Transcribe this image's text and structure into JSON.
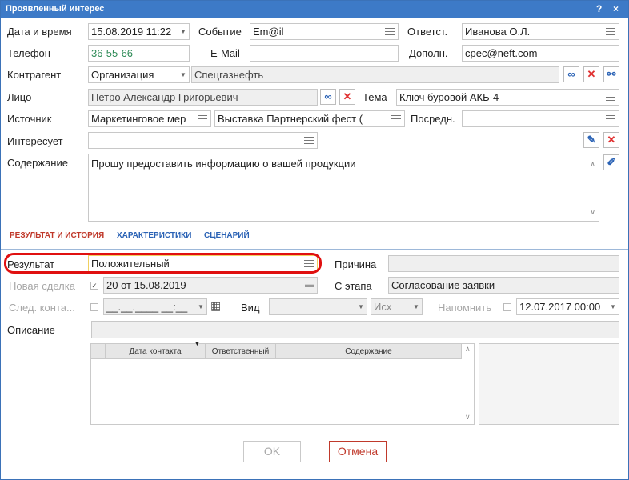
{
  "window": {
    "title": "Проявленный интерес",
    "help": "?",
    "close": "×"
  },
  "row1": {
    "datetime_label": "Дата и время",
    "datetime_value": "15.08.2019 11:22",
    "event_label": "Событие",
    "event_value": "Em@il",
    "resp_label": "Ответст.",
    "resp_value": "Иванова О.Л."
  },
  "row2": {
    "phone_label": "Телефон",
    "phone_value": "36-55-66",
    "email_label": "E-Mail",
    "email_value": "",
    "extra_label": "Дополн.",
    "extra_value": "cpec@neft.com"
  },
  "row3": {
    "contractor_label": "Контрагент",
    "contractor_type": "Организация",
    "contractor_value": "Спецгазнефть"
  },
  "row4": {
    "person_label": "Лицо",
    "person_value": "Петро Александр Григорьевич",
    "topic_label": "Тема",
    "topic_value": "Ключ буровой АКБ-4"
  },
  "row5": {
    "source_label": "Источник",
    "source_value": "Маркетинговое мер",
    "source2_value": "Выставка Партнерский фест (",
    "mediator_label": "Посредн.",
    "mediator_value": ""
  },
  "row6": {
    "interest_label": "Интересует",
    "interest_value": ""
  },
  "content": {
    "label": "Содержание",
    "value": "Прошу предоставить информацию о вашей продукции"
  },
  "tabs": [
    "РЕЗУЛЬТАТ И ИСТОРИЯ",
    "ХАРАКТЕРИСТИКИ",
    "СЦЕНАРИЙ"
  ],
  "result": {
    "result_label": "Результат",
    "result_value": "Положительный",
    "reason_label": "Причина",
    "reason_value": "",
    "deal_label": "Новая сделка",
    "deal_value": "20 от 15.08.2019",
    "stage_label": "С этапа",
    "stage_value": "Согласование заявки",
    "next_label": "След. конта...",
    "next_value": "__.__.____ __:__",
    "kind_label": "Вид",
    "kind_value": "",
    "dir_value": "Исх",
    "remind_label": "Напомнить",
    "remind_value": "12.07.2017 00:00",
    "desc_label": "Описание",
    "desc_value": ""
  },
  "grid": {
    "columns": [
      "Дата контакта",
      "Ответственный",
      "Содержание"
    ]
  },
  "buttons": {
    "ok": "OK",
    "cancel": "Отмена"
  }
}
